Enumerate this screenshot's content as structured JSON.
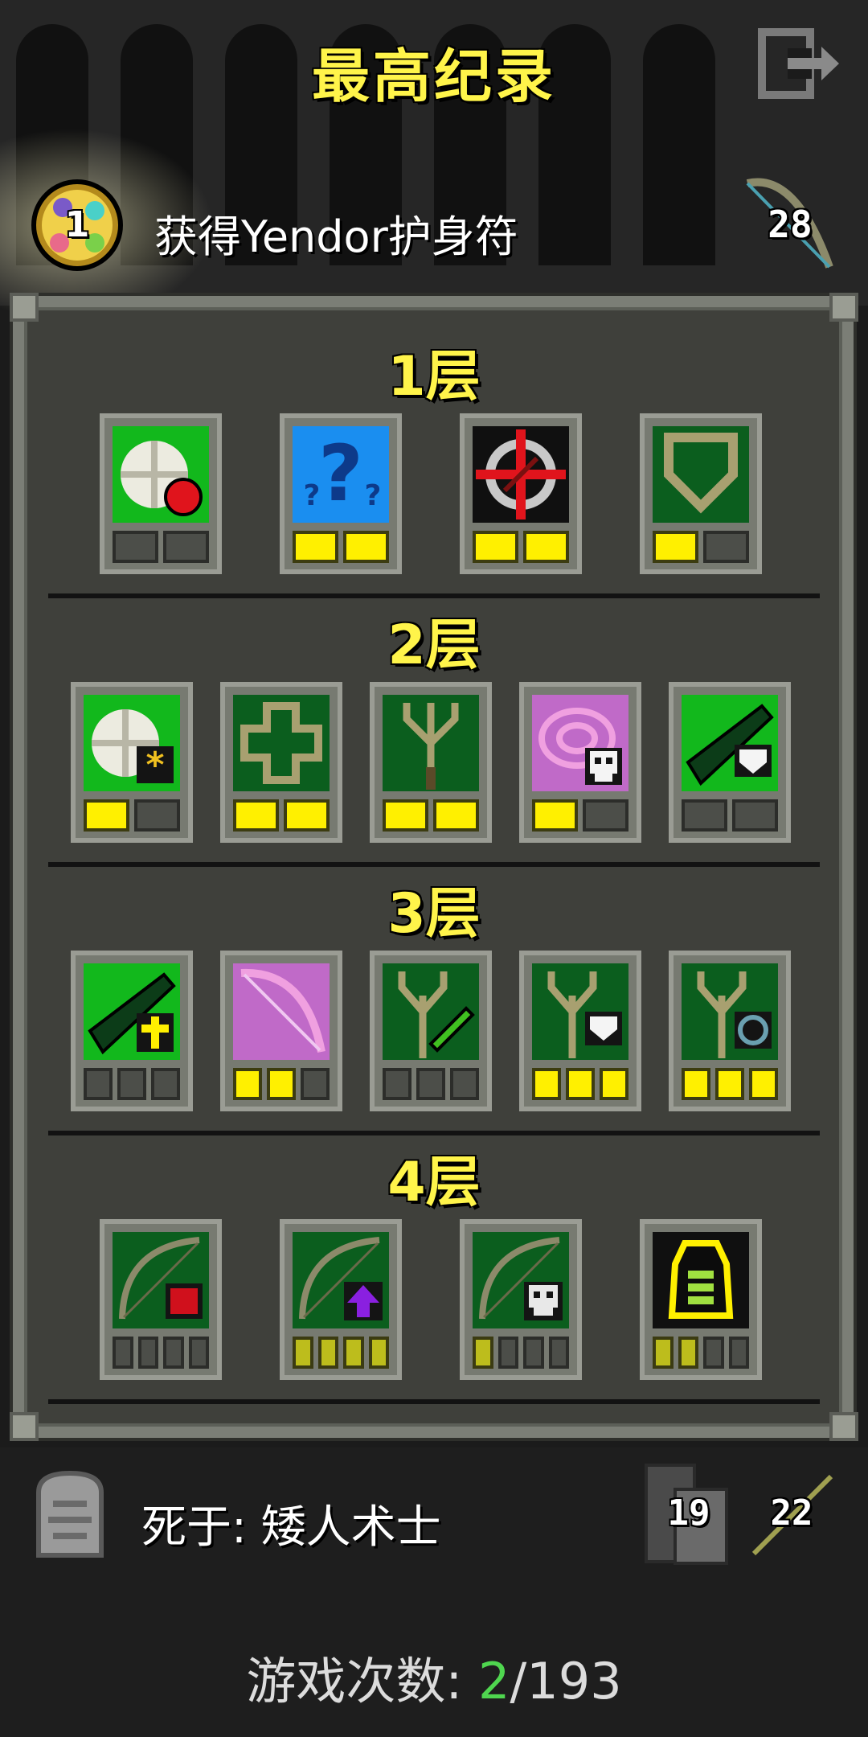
{
  "header": {
    "title": "最高纪录",
    "exit_icon": "exit-icon"
  },
  "record": {
    "badge_number": "1",
    "text": "获得Yendor护身符",
    "weapon_number": "28"
  },
  "floors": [
    {
      "label": "1层",
      "items": [
        {
          "icon": "apple-food-icon",
          "pips": [
            0,
            0
          ]
        },
        {
          "icon": "unknown-question-icon",
          "pips": [
            1,
            1
          ]
        },
        {
          "icon": "crosshair-target-icon",
          "pips": [
            1,
            1
          ]
        },
        {
          "icon": "shield-icon",
          "pips": [
            1,
            0
          ]
        }
      ]
    },
    {
      "label": "2层",
      "items": [
        {
          "icon": "food-star-icon",
          "pips": [
            1,
            0
          ]
        },
        {
          "icon": "cross-health-icon",
          "pips": [
            1,
            1
          ]
        },
        {
          "icon": "tree-icon",
          "pips": [
            1,
            1
          ]
        },
        {
          "icon": "pink-swirl-skull-icon",
          "pips": [
            1,
            0
          ]
        },
        {
          "icon": "weapon-shield-icon",
          "pips": [
            0,
            0
          ]
        }
      ]
    },
    {
      "label": "3层",
      "items": [
        {
          "icon": "weapon-cross-icon",
          "pips": [
            0,
            0,
            0
          ]
        },
        {
          "icon": "pink-bow-icon",
          "pips": [
            1,
            1,
            0
          ]
        },
        {
          "icon": "tree-dart-icon",
          "pips": [
            0,
            0,
            0
          ]
        },
        {
          "icon": "tree-shield-icon",
          "pips": [
            1,
            1,
            1
          ]
        },
        {
          "icon": "tree-ring-icon",
          "pips": [
            1,
            1,
            1
          ]
        }
      ]
    },
    {
      "label": "4层",
      "items": [
        {
          "icon": "bow-red-icon",
          "pips": [
            0,
            0,
            0,
            0
          ]
        },
        {
          "icon": "bow-purple-arrow-icon",
          "pips": [
            1,
            1,
            1,
            1
          ]
        },
        {
          "icon": "bow-skull-icon",
          "pips": [
            1,
            0,
            0,
            0
          ]
        },
        {
          "icon": "yellow-armor-icon",
          "pips": [
            1,
            1,
            0,
            0
          ]
        }
      ]
    }
  ],
  "death": {
    "text": "死于: 矮人术士",
    "depth_number": "19",
    "level_number": "22"
  },
  "games": {
    "label": "游戏次数:",
    "current": "2",
    "total": "/193"
  },
  "colors": {
    "title": "#fff44a",
    "pip_on": "#fff000",
    "current_games": "#4fd64f"
  }
}
